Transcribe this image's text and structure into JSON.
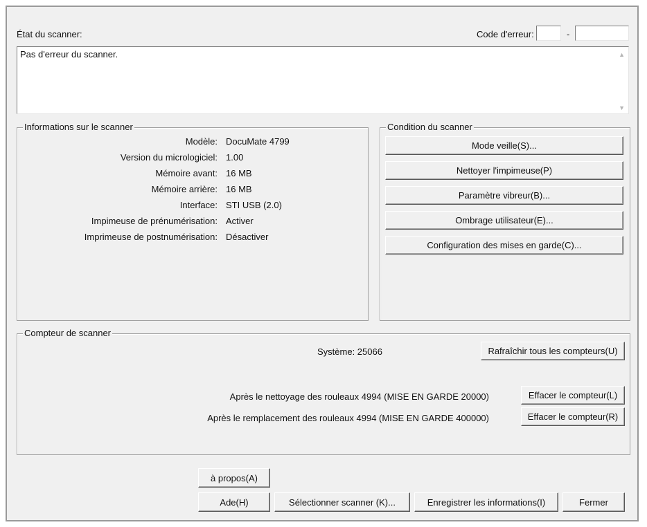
{
  "status": {
    "label": "État du scanner:",
    "error_code_label": "Code d'erreur:",
    "error_code_1": "",
    "error_code_sep": "-",
    "error_code_2": "",
    "message": "Pas d'erreur du scanner."
  },
  "info": {
    "title": "Informations sur le scanner",
    "rows": [
      {
        "label": "Modèle:",
        "value": "DocuMate 4799"
      },
      {
        "label": "Version du micrologiciel:",
        "value": "1.00"
      },
      {
        "label": "Mémoire avant:",
        "value": "16 MB"
      },
      {
        "label": "Mémoire arrière:",
        "value": "16 MB"
      },
      {
        "label": "Interface:",
        "value": "STI USB (2.0)"
      },
      {
        "label": "Impimeuse de prénumérisation:",
        "value": "Activer"
      },
      {
        "label": "Imprimeuse de postnumérisation:",
        "value": "Désactiver"
      }
    ]
  },
  "condition": {
    "title": "Condition du scanner",
    "buttons": [
      "Mode veille(S)...",
      "Nettoyer l'impimeuse(P)",
      "Paramètre vibreur(B)...",
      "Ombrage utilisateur(E)...",
      "Configuration des mises en garde(C)..."
    ]
  },
  "counter": {
    "title": "Compteur de scanner",
    "system": "Système: 25066",
    "refresh_button": "Rafraîchir tous les compteurs(U)",
    "cleaning": "Après le nettoyage des rouleaux 4994 (MISE EN GARDE 20000)",
    "clear_l_button": "Effacer le compteur(L)",
    "replacement": "Après le remplacement des rouleaux 4994 (MISE EN GARDE 400000)",
    "clear_r_button": "Effacer le compteur(R)"
  },
  "footer": {
    "about_button": "à propos(A)",
    "help_button": "Ade(H)",
    "select_button": "Sélectionner scanner (K)...",
    "save_button": "Enregistrer les informations(I)",
    "close_button": "Fermer"
  }
}
